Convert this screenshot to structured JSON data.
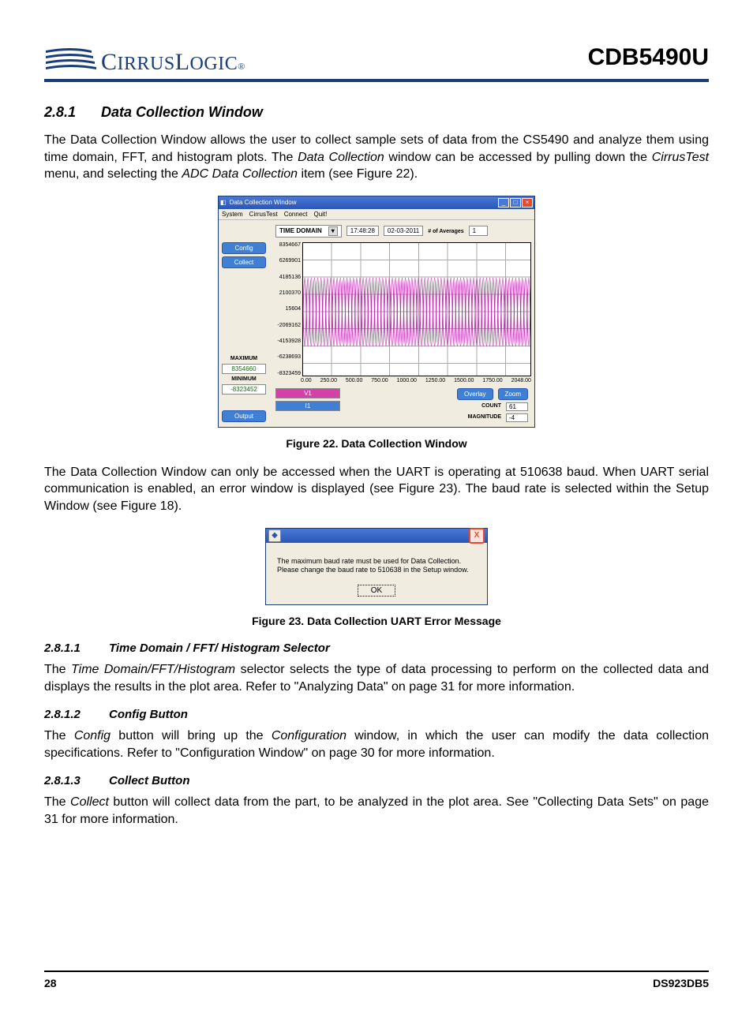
{
  "header": {
    "part_number": "CDB5490U",
    "logo_text": "CIRRUS LOGIC",
    "logo_reg": "®"
  },
  "sec": {
    "num": "2.8.1",
    "title": "Data Collection Window"
  },
  "p1_a": "The Data Collection Window allows the user to collect sample sets of data from the CS5490 and analyze them using time domain, FFT, and histogram plots. The ",
  "p1_i1": "Data Collection",
  "p1_b": " window can be accessed by pulling down the ",
  "p1_i2": "CirrusTest",
  "p1_c": " menu, and selecting the ",
  "p1_i3": "ADC Data Collection",
  "p1_d": " item (see ",
  "p1_link": "Figure 22",
  "p1_e": ").",
  "fig22": {
    "caption": "Figure 22.  Data Collection Window",
    "title": "Data Collection Window",
    "menu": [
      "System",
      "CirrusTest",
      "Connect",
      "Quit!"
    ],
    "mode": "TIME DOMAIN",
    "time": "17:48:28",
    "date": "02-03-2011",
    "avg_label": "# of Averages",
    "avg": "1",
    "btn_config": "Config",
    "btn_collect": "Collect",
    "btn_output": "Output",
    "max_label": "MAXIMUM",
    "max_val": "8354660",
    "min_label": "MINIMUM",
    "min_val": "-8323452",
    "yticks": [
      "8354667",
      "6269901",
      "4185136",
      "2100370",
      "15604",
      "-2069162",
      "-4153928",
      "-6238693",
      "-8323459"
    ],
    "xticks": [
      "0.00",
      "250.00",
      "500.00",
      "750.00",
      "1000.00",
      "1250.00",
      "1500.00",
      "1750.00",
      "2048.00"
    ],
    "chip_v1": "V1",
    "chip_i1": "I1",
    "btn_overlay": "Overlay",
    "btn_zoom": "Zoom",
    "count_label": "COUNT",
    "count": "61",
    "mag_label": "MAGNITUDE",
    "mag": "-4"
  },
  "p2": "The Data Collection Window can only be accessed when the UART is operating at 510638 baud. When UART serial communication is enabled, an error window is displayed (see Figure 23). The baud rate is selected within the Setup Window (see Figure 18).",
  "fig23": {
    "caption": "Figure 23.  Data Collection UART Error Message",
    "line1": "The maximum baud rate must be used for Data Collection.",
    "line2": "Please change the baud rate to 510638 in the Setup window.",
    "ok": "OK"
  },
  "s1": {
    "num": "2.8.1.1",
    "title": "Time Domain / FFT/ Histogram Selector"
  },
  "s1p_a": "The ",
  "s1p_i": "Time Domain/FFT/Histogram",
  "s1p_b": " selector selects the type of data processing to perform on the collected data and displays the results in the plot area. Refer to \"Analyzing Data\" on page 31 for more information.",
  "s2": {
    "num": "2.8.1.2",
    "title": "Config Button"
  },
  "s2p_a": "The ",
  "s2p_i": "Config",
  "s2p_b": " button will bring up the ",
  "s2p_i2": "Configuration",
  "s2p_c": " window, in which the user can modify the data collection specifications. Refer to \"Configuration Window\" on page 30 for more information.",
  "s3": {
    "num": "2.8.1.3",
    "title": "Collect Button"
  },
  "s3p_a": "The ",
  "s3p_i": "Collect",
  "s3p_b": " button will collect data from the part, to be analyzed in the plot area. See \"Collecting Data Sets\" on page 31 for more information.",
  "footer": {
    "page": "28",
    "doc": "DS923DB5"
  }
}
